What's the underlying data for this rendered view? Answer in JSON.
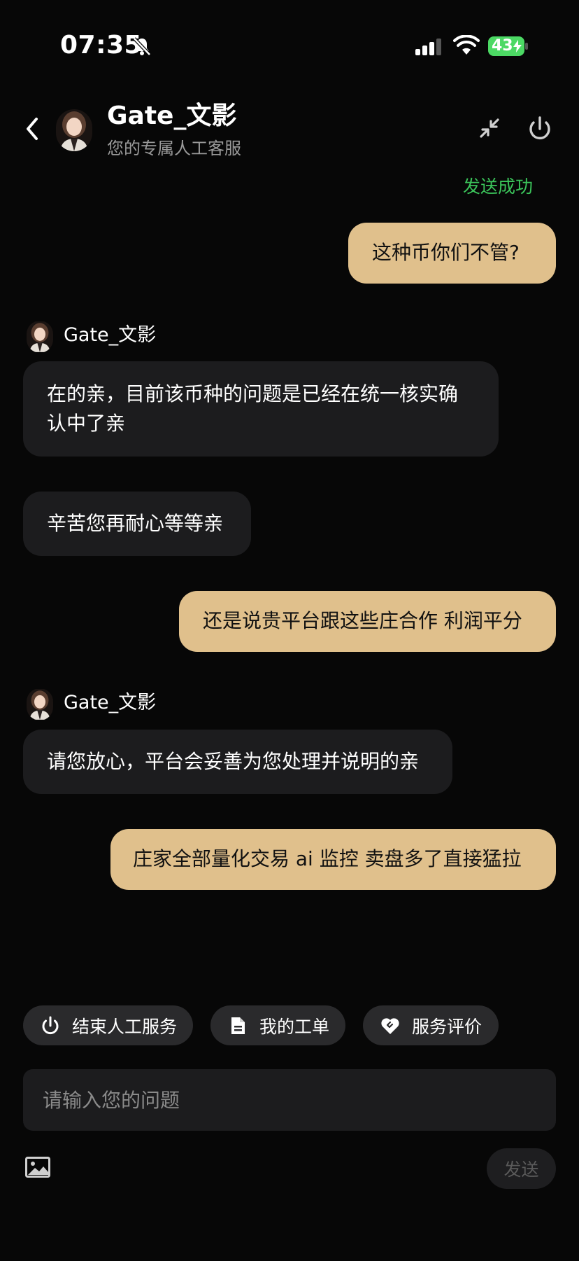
{
  "status_bar": {
    "time": "07:35",
    "battery": "43"
  },
  "header": {
    "agent_name": "Gate_文影",
    "agent_subtitle": "您的专属人工客服"
  },
  "chat": {
    "send_status": "发送成功",
    "messages": [
      {
        "from": "user",
        "lines": [
          "这种币你们不管?"
        ]
      },
      {
        "from": "agent",
        "sender": "Gate_文影",
        "lines": [
          "在的亲，目前该币种的问题是已经在统一核实确",
          "认中了亲"
        ]
      },
      {
        "from": "agent",
        "lines": [
          "辛苦您再耐心等等亲"
        ]
      },
      {
        "from": "user",
        "lines": [
          "还是说贵平台跟这些庄合作 利润平分"
        ]
      },
      {
        "from": "agent",
        "sender": "Gate_文影",
        "lines": [
          "请您放心，平台会妥善为您处理并说明的亲"
        ]
      },
      {
        "from": "user",
        "lines": [
          "庄家全部量化交易 ai 监控 卖盘多了直接猛拉"
        ]
      }
    ]
  },
  "quick_actions": [
    {
      "label": "结束人工服务",
      "icon": "power-icon"
    },
    {
      "label": "我的工单",
      "icon": "document-icon"
    },
    {
      "label": "服务评价",
      "icon": "heart-handshake-icon"
    }
  ],
  "composer": {
    "placeholder": "请输入您的问题",
    "value": "",
    "send_label": "发送",
    "image_icon": "image-icon"
  },
  "colors": {
    "background": "#070707",
    "user_bubble": "#e0c08c",
    "agent_bubble": "#1c1c1e",
    "success_text": "#3bc45a",
    "battery": "#4cd964"
  }
}
